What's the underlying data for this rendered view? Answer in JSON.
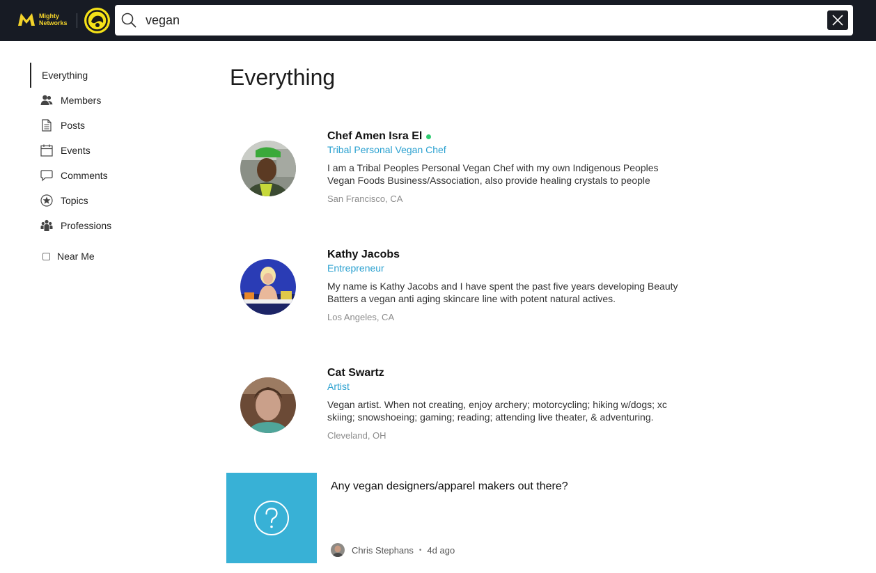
{
  "brand": {
    "line1": "Mighty",
    "line2": "Networks"
  },
  "search": {
    "value": "vegan",
    "placeholder": ""
  },
  "sidebar": {
    "items": [
      {
        "label": "Everything",
        "icon": "none"
      },
      {
        "label": "Members",
        "icon": "members-icon"
      },
      {
        "label": "Posts",
        "icon": "document-icon"
      },
      {
        "label": "Events",
        "icon": "calendar-icon"
      },
      {
        "label": "Comments",
        "icon": "speech-bubble-icon"
      },
      {
        "label": "Topics",
        "icon": "star-circle-icon"
      },
      {
        "label": "Professions",
        "icon": "group-icon"
      }
    ],
    "near_me": "Near Me"
  },
  "main": {
    "title": "Everything",
    "members": [
      {
        "name": "Chef Amen Isra El",
        "title": "Tribal Personal Vegan Chef",
        "bio": "I am a Tribal Peoples Personal Vegan Chef with my own Indigenous Peoples Vegan Foods Business/Association, also provide healing crystals to people",
        "location": "San Francisco, CA",
        "online": true
      },
      {
        "name": "Kathy Jacobs",
        "title": "Entrepreneur",
        "bio": "My name is Kathy Jacobs and I have spent the past five years developing Beauty Batters a vegan anti aging skincare line with potent natural actives.",
        "location": "Los Angeles, CA",
        "online": false
      },
      {
        "name": "Cat Swartz",
        "title": "Artist",
        "bio": "Vegan artist. When not creating, enjoy archery; motorcycling; hiking w/dogs; xc skiing; snowshoeing; gaming; reading; attending live theater, & adventuring.",
        "location": "Cleveland, OH",
        "online": false
      }
    ],
    "post": {
      "title": "Any vegan designers/apparel makers out there?",
      "author": "Chris Stephans",
      "separator": "•",
      "time": "4d ago"
    }
  },
  "colors": {
    "topbar": "#171b24",
    "brand_yellow": "#f3d32a",
    "accent_blue": "#2ba1d0",
    "post_thumb": "#38b1d6",
    "online_green": "#2ecc71"
  }
}
